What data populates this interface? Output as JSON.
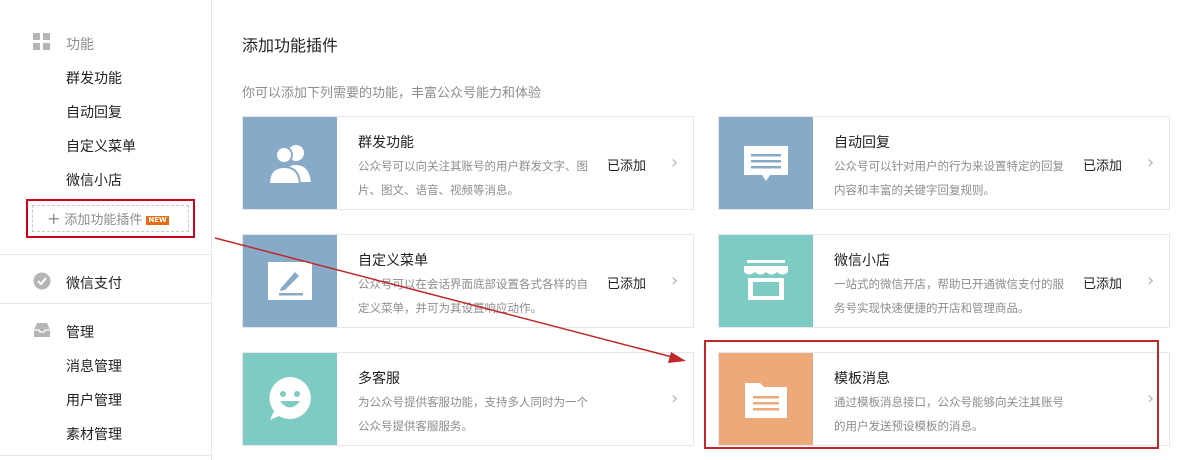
{
  "sidebar": {
    "func_head": "功能",
    "func_items": [
      "群发功能",
      "自动回复",
      "自定义菜单",
      "微信小店"
    ],
    "add_plugin_label": "添加功能插件",
    "add_plugin_badge": "NEW",
    "pay_head": "微信支付",
    "manage_head": "管理",
    "manage_items": [
      "消息管理",
      "用户管理",
      "素材管理"
    ]
  },
  "main": {
    "title": "添加功能插件",
    "subtitle": "你可以添加下列需要的功能，丰富公众号能力和体验",
    "cards": [
      {
        "title": "群发功能",
        "desc": "公众号可以向关注其账号的用户群发文字、图片、图文、语音、视频等消息。",
        "status": "已添加",
        "icon": "users-icon",
        "color": "#88aac9"
      },
      {
        "title": "自动回复",
        "desc": "公众号可以针对用户的行为来设置特定的回复内容和丰富的关键字回复规则。",
        "status": "已添加",
        "icon": "chat-bubble-icon",
        "color": "#88aac9"
      },
      {
        "title": "自定义菜单",
        "desc": "公众号可以在会话界面底部设置各式各样的自定义菜单，并可为其设置响应动作。",
        "status": "已添加",
        "icon": "edit-icon",
        "color": "#88aac9"
      },
      {
        "title": "微信小店",
        "desc": "一站式的微信开店，帮助已开通微信支付的服务号实现快速便捷的开店和管理商品。",
        "status": "已添加",
        "icon": "store-icon",
        "color": "#7ecbc4"
      },
      {
        "title": "多客服",
        "desc": "为公众号提供客服功能，支持多人同时为一个公众号提供客服服务。",
        "status": "",
        "icon": "smiley-icon",
        "color": "#7ecbc4"
      },
      {
        "title": "模板消息",
        "desc": "通过模板消息接口，公众号能够向关注其账号的用户发送预设模板的消息。",
        "status": "",
        "icon": "folder-icon",
        "color": "#eea97a"
      }
    ],
    "arrow_glyph": "›"
  },
  "colors": {
    "annotation_red": "#c0282b",
    "badge_orange": "#e96c13"
  }
}
